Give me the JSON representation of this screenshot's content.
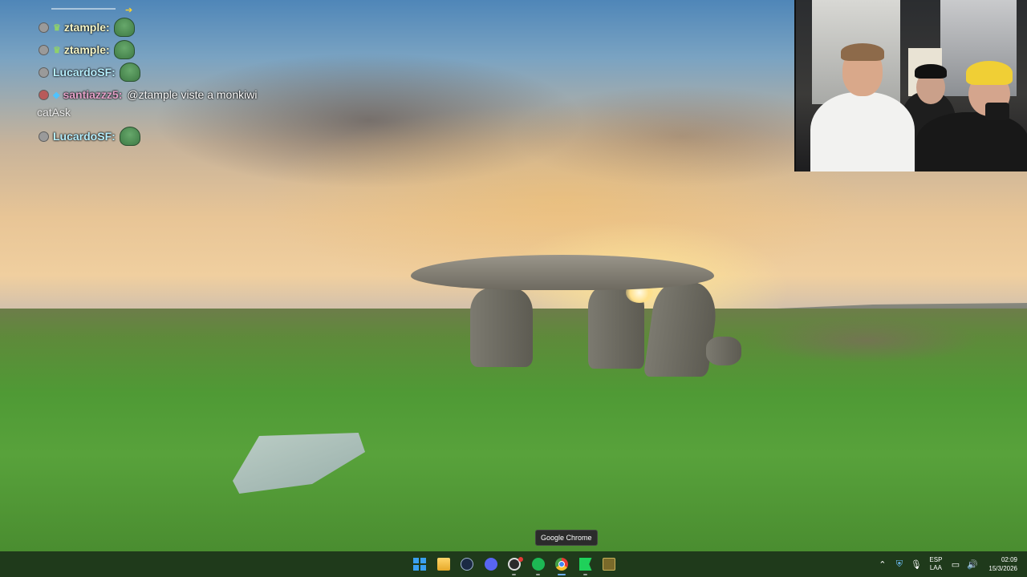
{
  "chat": {
    "messages": [
      {
        "user": "ztample:",
        "badge": "sub"
      },
      {
        "user": "ztample:",
        "badge": "sub"
      },
      {
        "user": "LucardoSF:"
      },
      {
        "user": "santiazzz5:",
        "text": "@ztample viste a monkiwi",
        "line2": "catAsk"
      },
      {
        "user": "LucardoSF:"
      }
    ]
  },
  "tooltip": {
    "text": "Google Chrome"
  },
  "taskbar": {
    "apps": [
      {
        "name": "start-icon"
      },
      {
        "name": "file-explorer-icon"
      },
      {
        "name": "steam-icon"
      },
      {
        "name": "discord-icon"
      },
      {
        "name": "obs-icon"
      },
      {
        "name": "spotify-icon"
      },
      {
        "name": "chrome-icon"
      },
      {
        "name": "green-flag-icon"
      },
      {
        "name": "game-icon"
      }
    ],
    "tray": {
      "lang_top": "ESP",
      "lang_bottom": "LAA",
      "time": "02:09",
      "date": "15/3/2026"
    }
  },
  "colors": {
    "taskbar_bg": "#1f3a1b",
    "accent": "#6fb0ff"
  }
}
